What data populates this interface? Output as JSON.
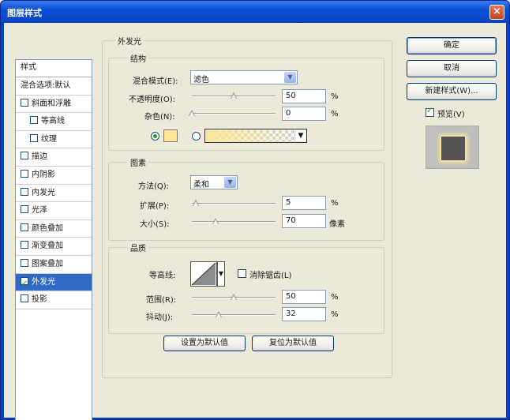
{
  "window": {
    "title": "图层样式",
    "close_glyph": "×"
  },
  "styles_list": {
    "header": "样式",
    "items": [
      {
        "label": "混合选项:默认",
        "has_checkbox": false,
        "checked": false,
        "sub": false,
        "selected": false
      },
      {
        "label": "斜面和浮雕",
        "has_checkbox": true,
        "checked": false,
        "sub": false,
        "selected": false
      },
      {
        "label": "等高线",
        "has_checkbox": true,
        "checked": false,
        "sub": true,
        "selected": false
      },
      {
        "label": "纹理",
        "has_checkbox": true,
        "checked": false,
        "sub": true,
        "selected": false
      },
      {
        "label": "描边",
        "has_checkbox": true,
        "checked": false,
        "sub": false,
        "selected": false
      },
      {
        "label": "内阴影",
        "has_checkbox": true,
        "checked": false,
        "sub": false,
        "selected": false
      },
      {
        "label": "内发光",
        "has_checkbox": true,
        "checked": false,
        "sub": false,
        "selected": false
      },
      {
        "label": "光泽",
        "has_checkbox": true,
        "checked": false,
        "sub": false,
        "selected": false
      },
      {
        "label": "颜色叠加",
        "has_checkbox": true,
        "checked": false,
        "sub": false,
        "selected": false
      },
      {
        "label": "渐变叠加",
        "has_checkbox": true,
        "checked": false,
        "sub": false,
        "selected": false
      },
      {
        "label": "图案叠加",
        "has_checkbox": true,
        "checked": false,
        "sub": false,
        "selected": false
      },
      {
        "label": "外发光",
        "has_checkbox": true,
        "checked": true,
        "sub": false,
        "selected": true
      },
      {
        "label": "投影",
        "has_checkbox": true,
        "checked": false,
        "sub": false,
        "selected": false
      }
    ]
  },
  "outer_glow": {
    "title": "外发光",
    "structure": {
      "title": "结构",
      "blend_mode_label": "混合模式(E):",
      "blend_mode_value": "滤色",
      "opacity_label": "不透明度(O):",
      "opacity_value": "50",
      "opacity_unit": "%",
      "opacity_fraction": 0.5,
      "noise_label": "杂色(N):",
      "noise_value": "0",
      "noise_unit": "%",
      "noise_fraction": 0.0,
      "glow_color": "#fce796"
    },
    "elements": {
      "title": "图素",
      "technique_label": "方法(Q):",
      "technique_value": "柔和",
      "spread_label": "扩展(P):",
      "spread_value": "5",
      "spread_unit": "%",
      "spread_fraction": 0.05,
      "size_label": "大小(S):",
      "size_value": "70",
      "size_unit": "像素",
      "size_fraction": 0.28
    },
    "quality": {
      "title": "品质",
      "contour_label": "等高线:",
      "antialiased_label": "消除锯齿(L)",
      "range_label": "范围(R):",
      "range_value": "50",
      "range_unit": "%",
      "range_fraction": 0.5,
      "jitter_label": "抖动(J):",
      "jitter_value": "32",
      "jitter_unit": "%",
      "jitter_fraction": 0.32
    },
    "set_default_label": "设置为默认值",
    "reset_default_label": "复位为默认值"
  },
  "buttons": {
    "ok": "确定",
    "cancel": "取消",
    "new_style": "新建样式(W)...",
    "preview_label": "预览(V)",
    "preview_checked": true
  }
}
